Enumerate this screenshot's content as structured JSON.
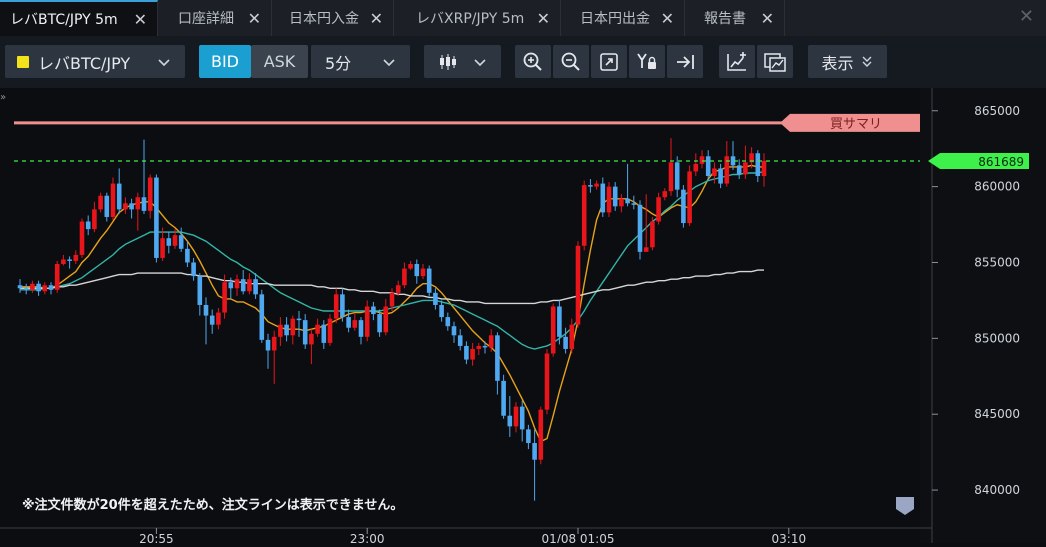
{
  "tabs": [
    {
      "label": "レバBTC/JPY 5m",
      "close": "✕"
    },
    {
      "label": "口座詳細",
      "close": "✕"
    },
    {
      "label": "日本円入金",
      "close": "✕"
    },
    {
      "label": "レバXRP/JPY 5m",
      "close": "✕"
    },
    {
      "label": "日本円出金",
      "close": "✕"
    },
    {
      "label": "報告書",
      "close": "✕"
    }
  ],
  "window_close": "✕",
  "toolbar": {
    "symbol": "レバBTC/JPY",
    "symbol_color": "#f3e21b",
    "bid": "BID",
    "ask": "ASK",
    "timeframe": "5分",
    "chart_type_icon": "candlestick-icon",
    "tools": [
      "zoom-in-icon",
      "zoom-out-icon",
      "fit-icon",
      "y-lock-icon",
      "jump-latest-icon",
      "add-indicator-icon",
      "chart-window-icon"
    ],
    "display": "表示"
  },
  "chart": {
    "summary_label": "買サマリ",
    "current_price_label": "861689",
    "notice": "※注文件数が20件を超えたため、注文ラインは表示できません。",
    "colors": {
      "up": "#e8151b",
      "down": "#4fa8f0",
      "ma_fast": "#e8a21a",
      "ma_mid": "#32b5a8",
      "ma_slow": "#d6d6d6",
      "current": "#3df04a",
      "summary": "#ef8f8f"
    }
  },
  "chart_data": {
    "type": "candlestick",
    "y_ticks": [
      "865000",
      "860000",
      "855000",
      "850000",
      "845000",
      "840000"
    ],
    "x_ticks": [
      "20:55",
      "23:00",
      "01/08 01:05",
      "03:10"
    ],
    "ylim": [
      837500,
      866500
    ],
    "summary_line": 864200,
    "current_price": 861689,
    "candles": [
      [
        853500,
        853300,
        853900,
        853000
      ],
      [
        853300,
        853200,
        853600,
        852900
      ],
      [
        853200,
        853600,
        853800,
        853000
      ],
      [
        853600,
        853100,
        853800,
        852800
      ],
      [
        853100,
        853500,
        853700,
        852900
      ],
      [
        853500,
        853200,
        853700,
        852900
      ],
      [
        853200,
        854900,
        855100,
        853000
      ],
      [
        854900,
        855200,
        855500,
        854800
      ],
      [
        855200,
        855100,
        855400,
        854600
      ],
      [
        855100,
        855500,
        855800,
        854900
      ],
      [
        855500,
        857700,
        857900,
        855300
      ],
      [
        857700,
        857200,
        858100,
        856800
      ],
      [
        857200,
        858500,
        859000,
        857000
      ],
      [
        858500,
        859400,
        859600,
        858300
      ],
      [
        859400,
        858000,
        859600,
        857700
      ],
      [
        858000,
        860200,
        860600,
        857800
      ],
      [
        860200,
        858500,
        861200,
        858200
      ],
      [
        858500,
        858900,
        859300,
        858200
      ],
      [
        858900,
        858500,
        859200,
        857900
      ],
      [
        858500,
        859300,
        859600,
        857100
      ],
      [
        859300,
        858400,
        863100,
        858200
      ],
      [
        858400,
        860600,
        860800,
        857900
      ],
      [
        860600,
        855300,
        860800,
        855000
      ],
      [
        855300,
        856600,
        857300,
        855100
      ],
      [
        856600,
        856100,
        857000,
        855600
      ],
      [
        856100,
        856800,
        857200,
        855900
      ],
      [
        856800,
        855900,
        857300,
        855700
      ],
      [
        855900,
        855000,
        856400,
        854700
      ],
      [
        855000,
        854100,
        855300,
        853800
      ],
      [
        854100,
        852200,
        854300,
        851500
      ],
      [
        852200,
        851500,
        852700,
        849600
      ],
      [
        851500,
        850900,
        851900,
        850300
      ],
      [
        850900,
        851700,
        852000,
        850600
      ],
      [
        851700,
        853700,
        854200,
        851300
      ],
      [
        853700,
        853300,
        854000,
        852600
      ],
      [
        853300,
        853900,
        854200,
        852800
      ],
      [
        853900,
        853100,
        854500,
        852900
      ],
      [
        853100,
        853900,
        854300,
        852900
      ],
      [
        853900,
        852900,
        854300,
        852600
      ],
      [
        852900,
        849900,
        853200,
        849700
      ],
      [
        849900,
        849200,
        850300,
        848000
      ],
      [
        849200,
        850100,
        850500,
        847000
      ],
      [
        850100,
        850900,
        851400,
        849500
      ],
      [
        850900,
        850200,
        851400,
        849800
      ],
      [
        850200,
        851300,
        851500,
        849600
      ],
      [
        851300,
        851200,
        851800,
        850100
      ],
      [
        851200,
        849600,
        851600,
        849300
      ],
      [
        849600,
        850300,
        850600,
        848300
      ],
      [
        850300,
        850900,
        851300,
        850100
      ],
      [
        850900,
        849700,
        851200,
        849300
      ],
      [
        849700,
        851300,
        851600,
        849500
      ],
      [
        851300,
        852900,
        853300,
        851000
      ],
      [
        852900,
        851400,
        853300,
        851100
      ],
      [
        851400,
        850700,
        851900,
        850400
      ],
      [
        850700,
        851200,
        851600,
        850500
      ],
      [
        851200,
        850100,
        851400,
        849600
      ],
      [
        850100,
        852100,
        852500,
        849800
      ],
      [
        852100,
        851600,
        852400,
        851200
      ],
      [
        851600,
        850400,
        851900,
        850100
      ],
      [
        850400,
        852100,
        852600,
        850200
      ],
      [
        852100,
        853000,
        853300,
        851800
      ],
      [
        853000,
        853500,
        853800,
        852800
      ],
      [
        853500,
        854600,
        855000,
        853300
      ],
      [
        854600,
        854900,
        855100,
        854500
      ],
      [
        854900,
        854100,
        855200,
        853600
      ],
      [
        854100,
        854600,
        854900,
        853900
      ],
      [
        854600,
        853000,
        854800,
        852700
      ],
      [
        853000,
        852200,
        853300,
        851900
      ],
      [
        852200,
        851400,
        852500,
        851100
      ],
      [
        851400,
        850800,
        851700,
        850500
      ],
      [
        850800,
        850200,
        851100,
        849700
      ],
      [
        850200,
        849500,
        850600,
        849200
      ],
      [
        849500,
        848600,
        849800,
        848300
      ],
      [
        848600,
        849300,
        849700,
        848200
      ],
      [
        849300,
        849500,
        849700,
        848900
      ],
      [
        849500,
        849400,
        849800,
        849000
      ],
      [
        849400,
        850200,
        850600,
        849100
      ],
      [
        850200,
        847200,
        850400,
        846300
      ],
      [
        847200,
        844900,
        847600,
        844700
      ],
      [
        844900,
        844200,
        846200,
        843500
      ],
      [
        844200,
        845500,
        845800,
        843800
      ],
      [
        845500,
        844000,
        845900,
        843200
      ],
      [
        844000,
        843100,
        844300,
        842700
      ],
      [
        843100,
        842000,
        844000,
        839300
      ],
      [
        842000,
        845300,
        845500,
        841700
      ],
      [
        845300,
        849000,
        849300,
        845000
      ],
      [
        849000,
        852100,
        852300,
        848800
      ],
      [
        852100,
        850100,
        852500,
        849600
      ],
      [
        850100,
        849300,
        850700,
        849000
      ],
      [
        849300,
        850900,
        851300,
        849000
      ],
      [
        850900,
        856100,
        856400,
        850700
      ],
      [
        856100,
        860100,
        860400,
        855800
      ],
      [
        860100,
        860000,
        860500,
        859600
      ],
      [
        860000,
        860200,
        860400,
        859800
      ],
      [
        860200,
        858300,
        860600,
        858000
      ],
      [
        858300,
        860000,
        860300,
        858000
      ],
      [
        860000,
        858700,
        860300,
        858400
      ],
      [
        858700,
        859200,
        859500,
        858300
      ],
      [
        859200,
        858900,
        861500,
        858700
      ],
      [
        858900,
        858800,
        859400,
        858500
      ],
      [
        858800,
        855700,
        859100,
        855200
      ],
      [
        855700,
        856000,
        859500,
        855800
      ],
      [
        856000,
        857700,
        858000,
        855800
      ],
      [
        857700,
        859300,
        859600,
        857500
      ],
      [
        859300,
        859700,
        859900,
        859100
      ],
      [
        859700,
        861600,
        863200,
        859400
      ],
      [
        861600,
        859800,
        862000,
        859300
      ],
      [
        859800,
        857600,
        860100,
        857300
      ],
      [
        857600,
        861000,
        861400,
        857400
      ],
      [
        861000,
        861500,
        862200,
        860700
      ],
      [
        861500,
        862000,
        862400,
        861200
      ],
      [
        862000,
        860700,
        862400,
        860400
      ],
      [
        860700,
        861200,
        861600,
        860200
      ],
      [
        861200,
        860200,
        861500,
        859900
      ],
      [
        860200,
        862000,
        863000,
        860000
      ],
      [
        862000,
        861400,
        863000,
        861100
      ],
      [
        861400,
        860800,
        861800,
        860500
      ],
      [
        860800,
        861600,
        862700,
        860500
      ],
      [
        861600,
        862200,
        862600,
        861200
      ],
      [
        862200,
        860700,
        862400,
        860300
      ],
      [
        860700,
        861700,
        862200,
        860000
      ]
    ],
    "series": [
      {
        "name": "ma_fast",
        "values": [
          853400,
          853400,
          853400,
          853400,
          853300,
          853300,
          853500,
          853800,
          854100,
          854400,
          855000,
          855400,
          856000,
          856600,
          857100,
          857700,
          858300,
          858600,
          858800,
          858900,
          859000,
          859000,
          858600,
          858100,
          857600,
          857300,
          856900,
          856400,
          855800,
          855100,
          854300,
          853500,
          852800,
          852600,
          852600,
          852400,
          852400,
          852200,
          852000,
          851600,
          851100,
          850900,
          850700,
          850600,
          850600,
          850600,
          850500,
          850600,
          850700,
          850800,
          851000,
          851200,
          851400,
          851600,
          851700,
          851700,
          851800,
          851800,
          851700,
          851600,
          851700,
          852000,
          852400,
          852800,
          853300,
          853600,
          853600,
          853400,
          853000,
          852500,
          852000,
          851500,
          851000,
          850500,
          850100,
          849700,
          849400,
          849000,
          848300,
          847600,
          846800,
          846000,
          845200,
          844100,
          843200,
          843400,
          844900,
          846500,
          847900,
          849300,
          851200,
          853600,
          855800,
          857800,
          858900,
          859200,
          859200,
          859200,
          859200,
          859000,
          858700,
          858500,
          858200,
          858000,
          858300,
          858600,
          858800,
          858700,
          858600,
          859000,
          859700,
          860500,
          861000,
          861100,
          861300,
          861300,
          861300,
          861300,
          861400,
          861300,
          861300
        ]
      },
      {
        "name": "ma_mid",
        "values": [
          853200,
          853200,
          853200,
          853200,
          853300,
          853300,
          853400,
          853500,
          853600,
          853800,
          854000,
          854300,
          854600,
          854900,
          855200,
          855500,
          855900,
          856200,
          856400,
          856600,
          856800,
          857000,
          857000,
          857000,
          857000,
          857000,
          857000,
          856900,
          856800,
          856600,
          856400,
          856100,
          855800,
          855500,
          855200,
          855000,
          854700,
          854500,
          854200,
          853900,
          853600,
          853300,
          853000,
          852800,
          852600,
          852400,
          852200,
          852000,
          851900,
          851800,
          851800,
          851800,
          851800,
          851800,
          851800,
          851800,
          851800,
          851800,
          851800,
          851900,
          852000,
          852100,
          852200,
          852300,
          852400,
          852500,
          852500,
          852500,
          852400,
          852300,
          852200,
          852000,
          851800,
          851600,
          851400,
          851200,
          851000,
          850800,
          850500,
          850200,
          849900,
          849600,
          849400,
          849300,
          849400,
          849500,
          849700,
          850000,
          850300,
          850700,
          851200,
          851800,
          852500,
          853100,
          853700,
          854300,
          854900,
          855500,
          856100,
          856500,
          856900,
          857300,
          857700,
          858000,
          858400,
          858700,
          859100,
          859400,
          859700,
          860000,
          860200,
          860400,
          860500,
          860600,
          860700,
          860800,
          860800,
          860900,
          860900,
          860900,
          861000
        ]
      },
      {
        "name": "ma_slow",
        "values": [
          853300,
          853300,
          853300,
          853300,
          853300,
          853300,
          853400,
          853400,
          853500,
          853500,
          853600,
          853700,
          853800,
          853900,
          854000,
          854100,
          854200,
          854200,
          854200,
          854300,
          854300,
          854300,
          854300,
          854300,
          854300,
          854300,
          854300,
          854200,
          854200,
          854100,
          854100,
          854000,
          853900,
          853800,
          853800,
          853700,
          853700,
          853600,
          853600,
          853600,
          853600,
          853500,
          853500,
          853500,
          853500,
          853500,
          853500,
          853500,
          853400,
          853400,
          853300,
          853300,
          853300,
          853200,
          853200,
          853100,
          853100,
          853100,
          853000,
          853000,
          853000,
          852900,
          852900,
          852800,
          852800,
          852800,
          852700,
          852700,
          852600,
          852600,
          852500,
          852500,
          852400,
          852400,
          852400,
          852300,
          852300,
          852300,
          852300,
          852300,
          852300,
          852300,
          852300,
          852300,
          852400,
          852400,
          852500,
          852500,
          852600,
          852700,
          852800,
          852900,
          853000,
          853100,
          853200,
          853200,
          853300,
          853400,
          853500,
          853500,
          853600,
          853700,
          853700,
          853800,
          853800,
          853900,
          853900,
          854000,
          854000,
          854100,
          854100,
          854100,
          854200,
          854200,
          854300,
          854300,
          854400,
          854400,
          854400,
          854500,
          854500
        ]
      }
    ]
  }
}
